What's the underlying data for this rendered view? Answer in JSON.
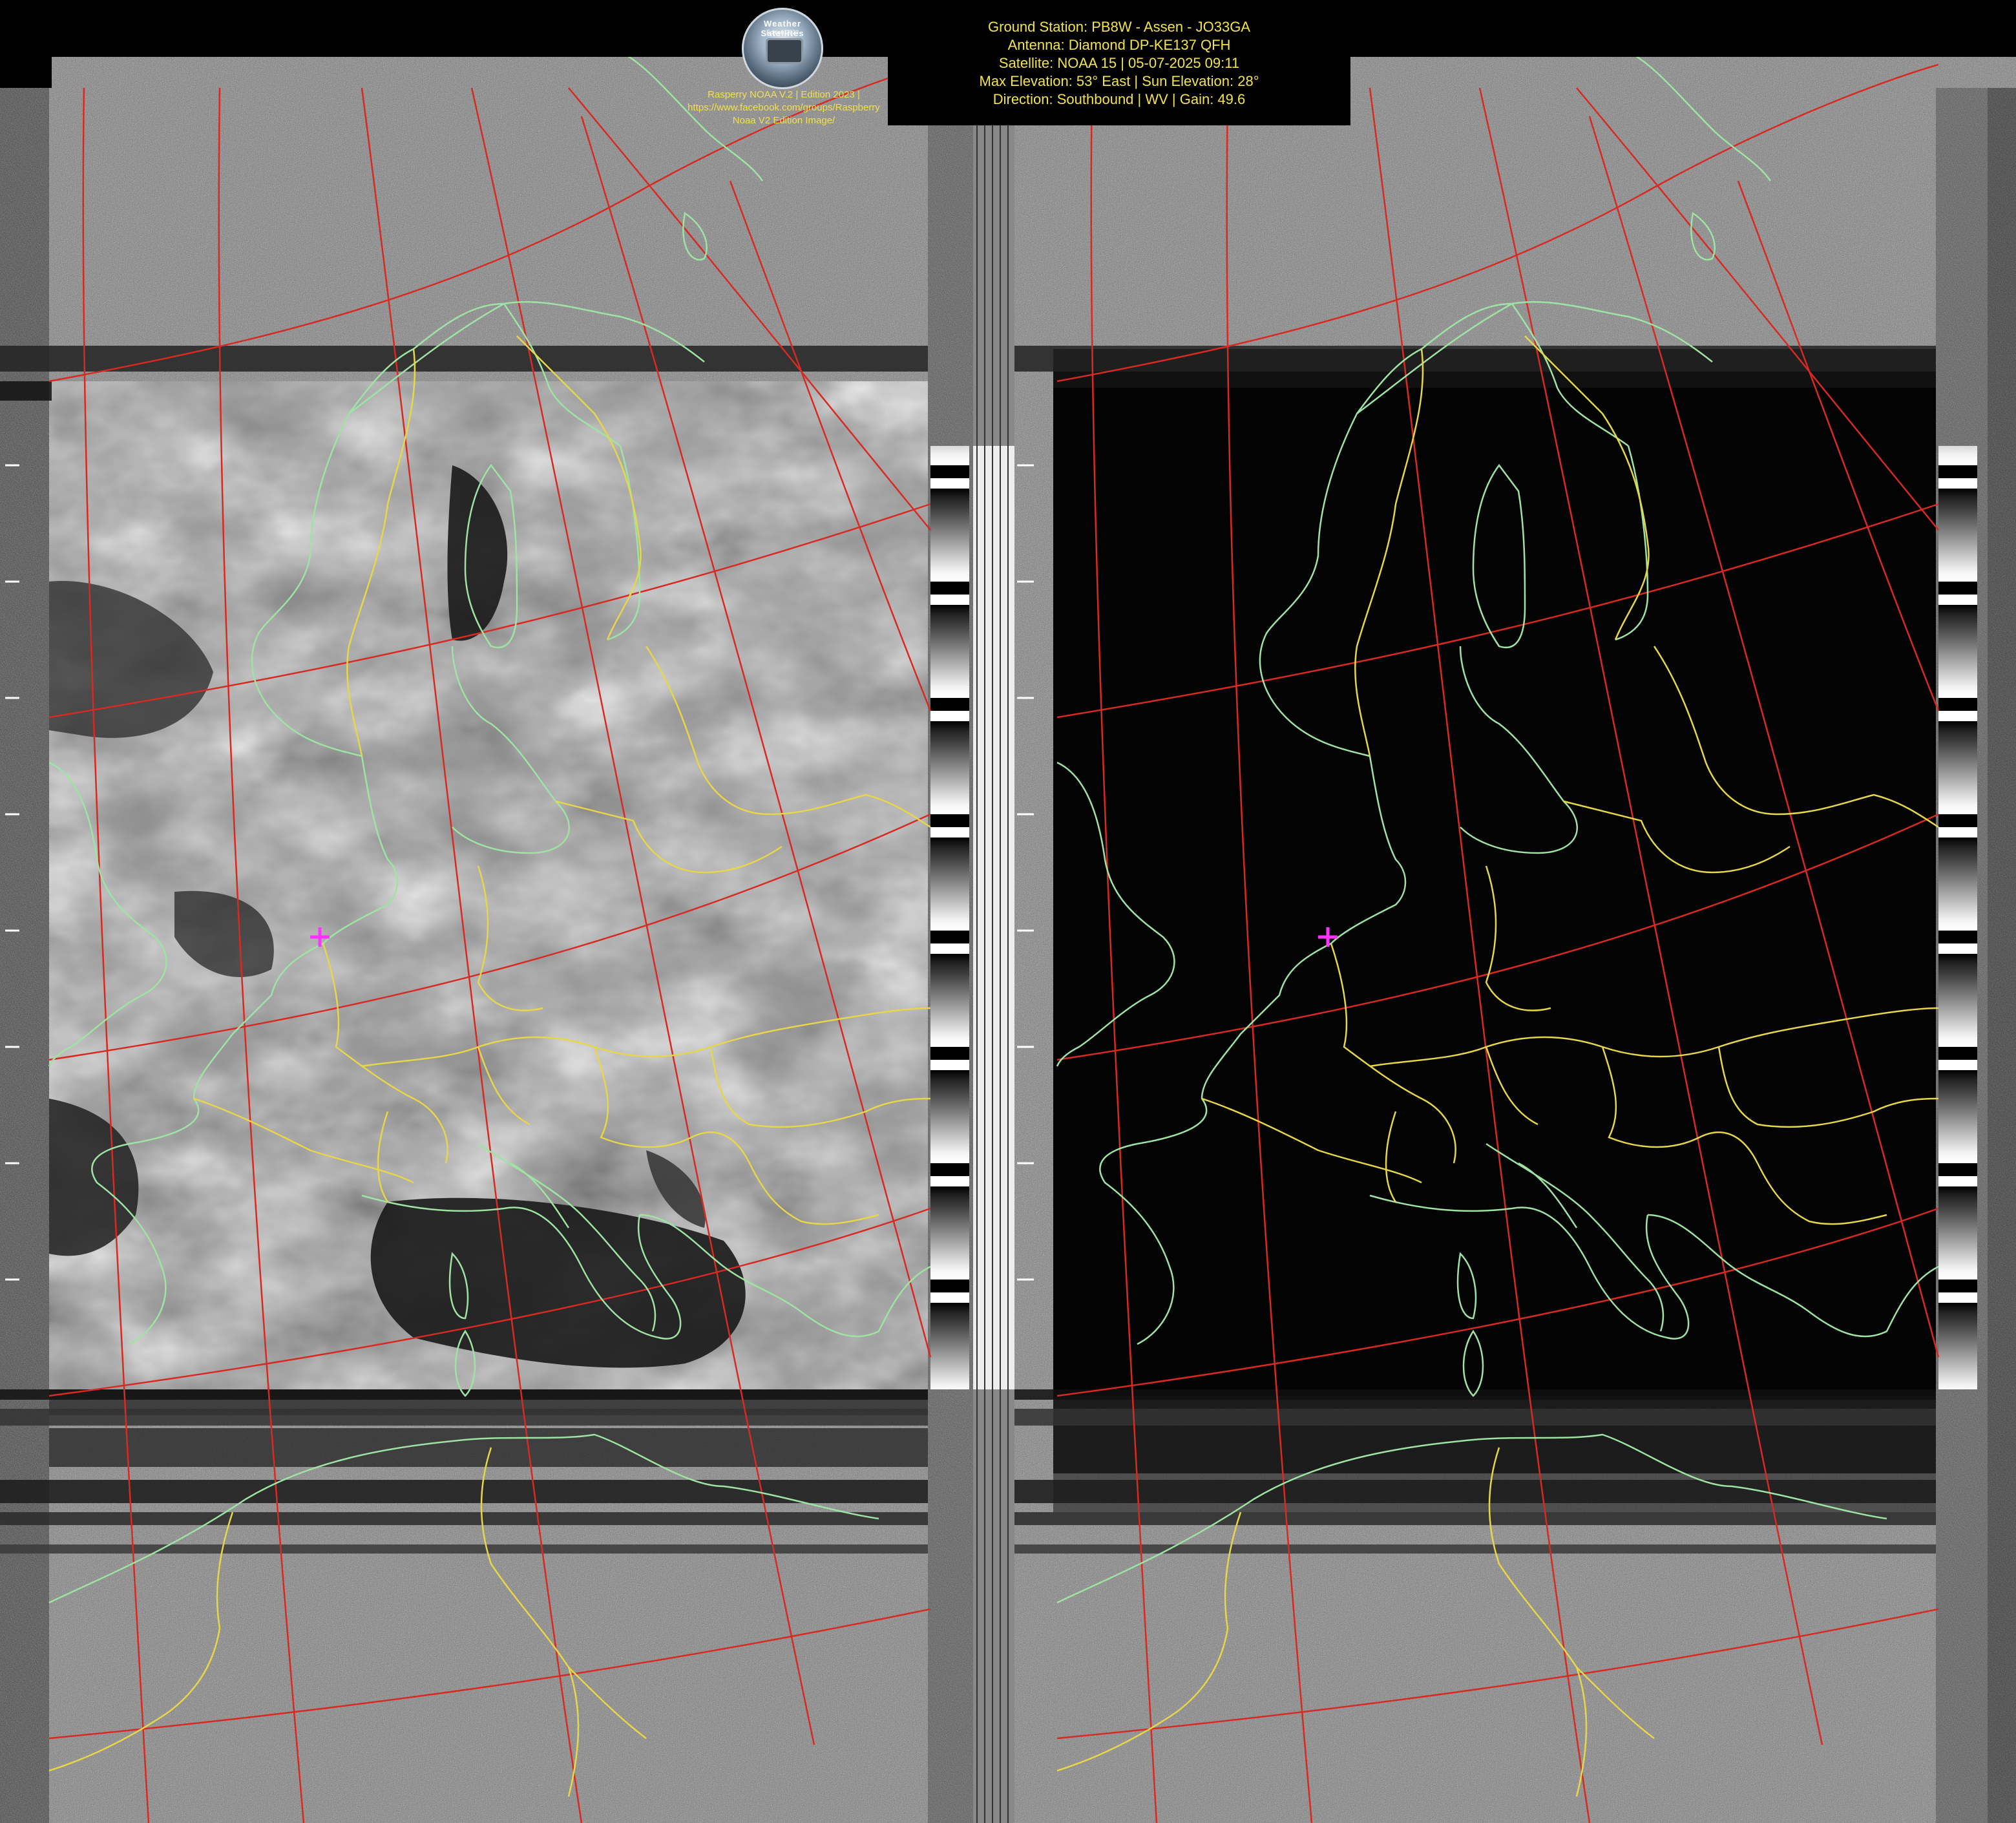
{
  "branding": {
    "logo_label": "Weather Satellites",
    "logo_sub": "Edition 2023",
    "line1": "Rasperry NOAA V.2 | Edition 2023 |",
    "line2": "https://www.facebook.com/groups/Raspberry",
    "line3": "Noaa V2 Edition Image/"
  },
  "station_info": {
    "ground_station": "Ground Station: PB8W - Assen - JO33GA",
    "antenna": "Antenna: Diamond DP-KE137 QFH",
    "satellite": "Satellite: NOAA 15 | 05-07-2025 09:11",
    "elevation": "Max Elevation: 53° East | Sun Elevation: 28°",
    "direction": "Direction: Southbound | WV | Gain: 49.6"
  },
  "colors": {
    "station_text": "#f3e34c",
    "coastline": "#9ee3a4",
    "borders": "#e6d64a",
    "grid": "#d62a22",
    "location_marker": "#ff33ff"
  },
  "panels": [
    {
      "id": "left",
      "channel": "visible",
      "style": "grayscale clouds"
    },
    {
      "id": "right",
      "channel": "infrared",
      "style": "dark land/sea"
    }
  ]
}
